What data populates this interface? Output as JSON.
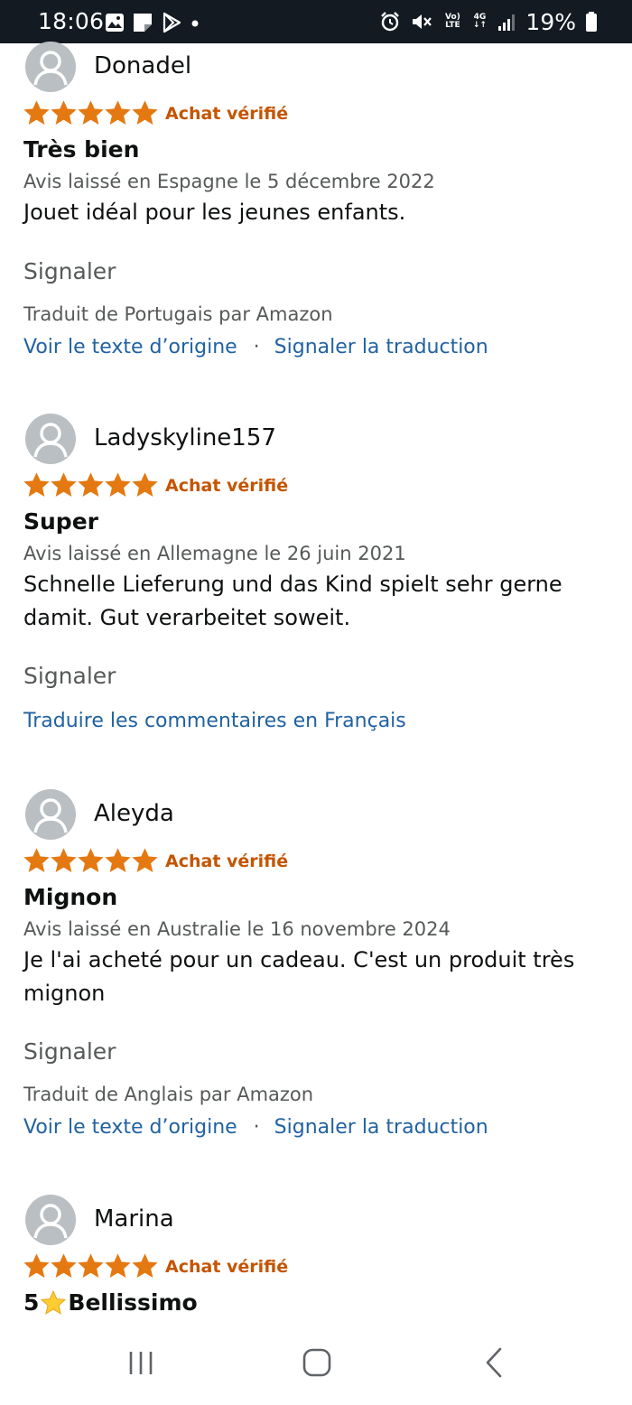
{
  "status_bar": {
    "time": "18:06",
    "battery_percent": "19%",
    "network_top": "Vo)",
    "network_bottom": "LTE",
    "data_top": "4G",
    "data_bottom": "↓↑",
    "icons": [
      "gallery-icon",
      "note-icon",
      "play-store-icon",
      "notification-dot-icon",
      "alarm-icon",
      "mute-icon",
      "volte-icon",
      "4g-icon",
      "signal-icon",
      "battery-icon"
    ]
  },
  "colors": {
    "star": "#e47911",
    "verified": "#c45500",
    "link": "#2162a1",
    "secondary_text": "#565959",
    "status_bar_bg": "#131a22"
  },
  "reviews": [
    {
      "name": "Donadel",
      "rating": 5,
      "verified": "Achat vérifié",
      "title": "Très bien",
      "meta": "Avis laissé en Espagne le 5 décembre 2022",
      "body": "Jouet idéal pour les jeunes enfants.",
      "report": "Signaler",
      "translated_by": "Traduit de Portugais par Amazon",
      "see_original": "Voir le texte d’origine",
      "separator": "·",
      "report_translation": "Signaler la traduction"
    },
    {
      "name": "Ladyskyline157",
      "rating": 5,
      "verified": "Achat vérifié",
      "title": "Super",
      "meta": "Avis laissé en Allemagne le 26 juin 2021",
      "body": "Schnelle Lieferung und das Kind spielt sehr gerne damit. Gut verarbeitet soweit.",
      "report": "Signaler",
      "translate_link": "Traduire les commentaires en Français"
    },
    {
      "name": "Aleyda",
      "rating": 5,
      "verified": "Achat vérifié",
      "title": "Mignon",
      "meta": "Avis laissé en Australie le 16 novembre 2024",
      "body": "Je l'ai acheté pour un cadeau. C'est un produit très mignon",
      "report": "Signaler",
      "translated_by": "Traduit de Anglais par Amazon",
      "see_original": "Voir le texte d’origine",
      "separator": "·",
      "report_translation": "Signaler la traduction"
    },
    {
      "name": "Marina",
      "rating": 5,
      "verified": "Achat vérifié",
      "title_prefix": "5",
      "title_emoji": "star-emoji-icon",
      "title": "Bellissimo"
    }
  ],
  "nav_bar": {
    "buttons": [
      "recent-apps",
      "home",
      "back"
    ]
  }
}
